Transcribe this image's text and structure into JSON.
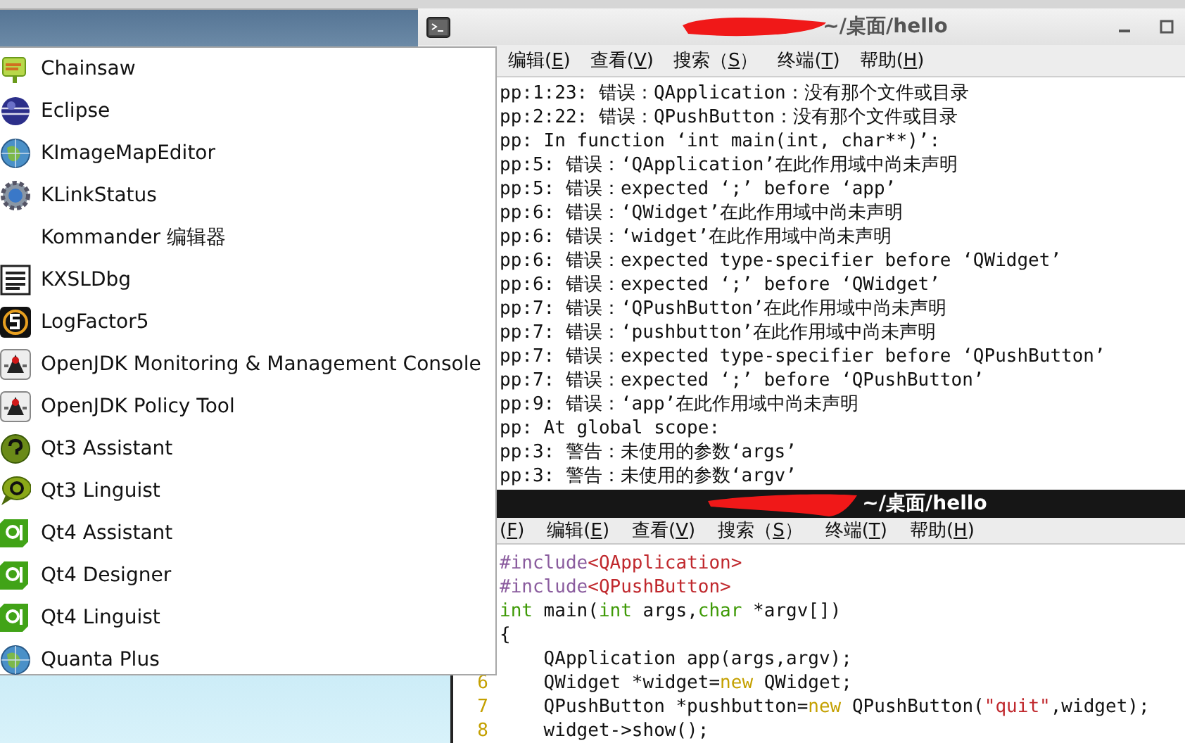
{
  "launcher_menu": {
    "items": [
      {
        "label": "Chainsaw"
      },
      {
        "label": "Eclipse"
      },
      {
        "label": "KImageMapEditor"
      },
      {
        "label": "KLinkStatus"
      },
      {
        "label": "Kommander 编辑器"
      },
      {
        "label": "KXSLDbg"
      },
      {
        "label": "LogFactor5"
      },
      {
        "label": "OpenJDK Monitoring & Management Console"
      },
      {
        "label": "OpenJDK Policy Tool"
      },
      {
        "label": "Qt3 Assistant"
      },
      {
        "label": "Qt3 Linguist"
      },
      {
        "label": "Qt4 Assistant"
      },
      {
        "label": "Qt4 Designer"
      },
      {
        "label": "Qt4 Linguist"
      },
      {
        "label": "Quanta Plus"
      }
    ]
  },
  "terminal_back": {
    "title": "~/桌面/hello",
    "menu": [
      {
        "before": "编辑(",
        "key": "E",
        "after": ")"
      },
      {
        "before": "查看(",
        "key": "V",
        "after": ")"
      },
      {
        "before": "搜索（",
        "key": "S",
        "after": "）"
      },
      {
        "before": "终端(",
        "key": "T",
        "after": ")"
      },
      {
        "before": "帮助(",
        "key": "H",
        "after": ")"
      }
    ],
    "output_lines": [
      "pp:1:23: 错误：QApplication：没有那个文件或目录",
      "pp:2:22: 错误：QPushButton：没有那个文件或目录",
      "pp: In function ‘int main(int, char**)’:",
      "pp:5: 错误：‘QApplication’在此作用域中尚未声明",
      "pp:5: 错误：expected ‘;’ before ‘app’",
      "pp:6: 错误：‘QWidget’在此作用域中尚未声明",
      "pp:6: 错误：‘widget’在此作用域中尚未声明",
      "pp:6: 错误：expected type-specifier before ‘QWidget’",
      "pp:6: 错误：expected ‘;’ before ‘QWidget’",
      "pp:7: 错误：‘QPushButton’在此作用域中尚未声明",
      "pp:7: 错误：‘pushbutton’在此作用域中尚未声明",
      "pp:7: 错误：expected type-specifier before ‘QPushButton’",
      "pp:7: 错误：expected ‘;’ before ‘QPushButton’",
      "pp:9: 错误：‘app’在此作用域中尚未声明",
      "pp: At global scope:",
      "pp:3: 警告：未使用的参数‘args’",
      "pp:3: 警告：未使用的参数‘argv’"
    ]
  },
  "terminal_front": {
    "title": "~/桌面/hello",
    "menu": [
      {
        "before": "(",
        "key": "F",
        "after": ")"
      },
      {
        "before": "编辑(",
        "key": "E",
        "after": ")"
      },
      {
        "before": "查看(",
        "key": "V",
        "after": ")"
      },
      {
        "before": "搜索（",
        "key": "S",
        "after": "）"
      },
      {
        "before": "终端(",
        "key": "T",
        "after": ")"
      },
      {
        "before": "帮助(",
        "key": "H",
        "after": ")"
      }
    ],
    "code_lines": [
      {
        "segments": [
          {
            "kind": "preproc",
            "text": "#include"
          },
          {
            "kind": "string",
            "text": "<QApplication>"
          }
        ]
      },
      {
        "segments": [
          {
            "kind": "preproc",
            "text": "#include"
          },
          {
            "kind": "string",
            "text": "<QPushButton>"
          }
        ]
      },
      {
        "segments": [
          {
            "kind": "type",
            "text": "int"
          },
          {
            "kind": "plain",
            "text": " main("
          },
          {
            "kind": "type",
            "text": "int"
          },
          {
            "kind": "plain",
            "text": " args,"
          },
          {
            "kind": "type",
            "text": "char"
          },
          {
            "kind": "plain",
            "text": " *argv[])"
          }
        ]
      },
      {
        "segments": [
          {
            "kind": "plain",
            "text": "{"
          }
        ]
      },
      {
        "segments": [
          {
            "kind": "plain",
            "text": "    QApplication app(args,argv);"
          }
        ]
      },
      {
        "line_number": "6",
        "segments": [
          {
            "kind": "plain",
            "text": "    QWidget *widget="
          },
          {
            "kind": "keyword",
            "text": "new"
          },
          {
            "kind": "plain",
            "text": " QWidget;"
          }
        ]
      },
      {
        "line_number": "7",
        "segments": [
          {
            "kind": "plain",
            "text": "    QPushButton *pushbutton="
          },
          {
            "kind": "keyword",
            "text": "new"
          },
          {
            "kind": "plain",
            "text": " QPushButton("
          },
          {
            "kind": "string",
            "text": "\"quit\""
          },
          {
            "kind": "plain",
            "text": ",widget);"
          }
        ]
      },
      {
        "line_number": "8",
        "segments": [
          {
            "kind": "plain",
            "text": "    widget->show();"
          }
        ]
      }
    ]
  }
}
